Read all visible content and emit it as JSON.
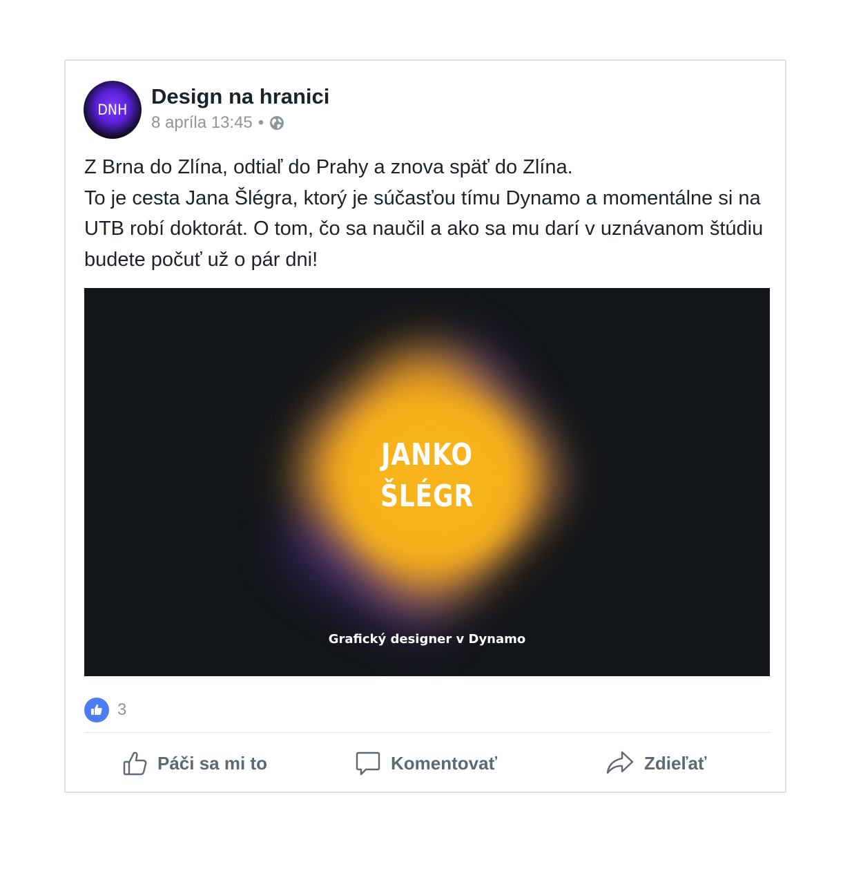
{
  "post": {
    "avatar_text": "DNH",
    "page_name": "Design na hranici",
    "timestamp": "8 apríla 13:45",
    "separator": "•",
    "privacy_icon": "globe-icon",
    "text_lines": [
      "Z Brna do Zlína, odtiaľ do Prahy a znova späť do Zlína.",
      "To je cesta Jana Šlégra, ktorý je súčasťou tímu Dynamo a momentálne si na UTB robí doktorát. O tom, čo sa naučil a ako sa mu darí v uznávanom štúdiu budete počuť už o pár dni!"
    ]
  },
  "media": {
    "title_line1": "JANKO",
    "title_line2": "ŠLÉGR",
    "subtitle": "Grafický designer v Dynamo",
    "background_color": "#121519",
    "accent_colors": [
      "#f7b31c",
      "#6a3fc8"
    ]
  },
  "reactions": {
    "icon": "like-icon",
    "count": "3"
  },
  "actions": {
    "like_label": "Páči sa mi to",
    "comment_label": "Komentovať",
    "share_label": "Zdieľať"
  },
  "colors": {
    "brand_blue": "#4a7cf3",
    "text": "#1d2129",
    "muted": "#90949c",
    "action_text": "#606770"
  }
}
